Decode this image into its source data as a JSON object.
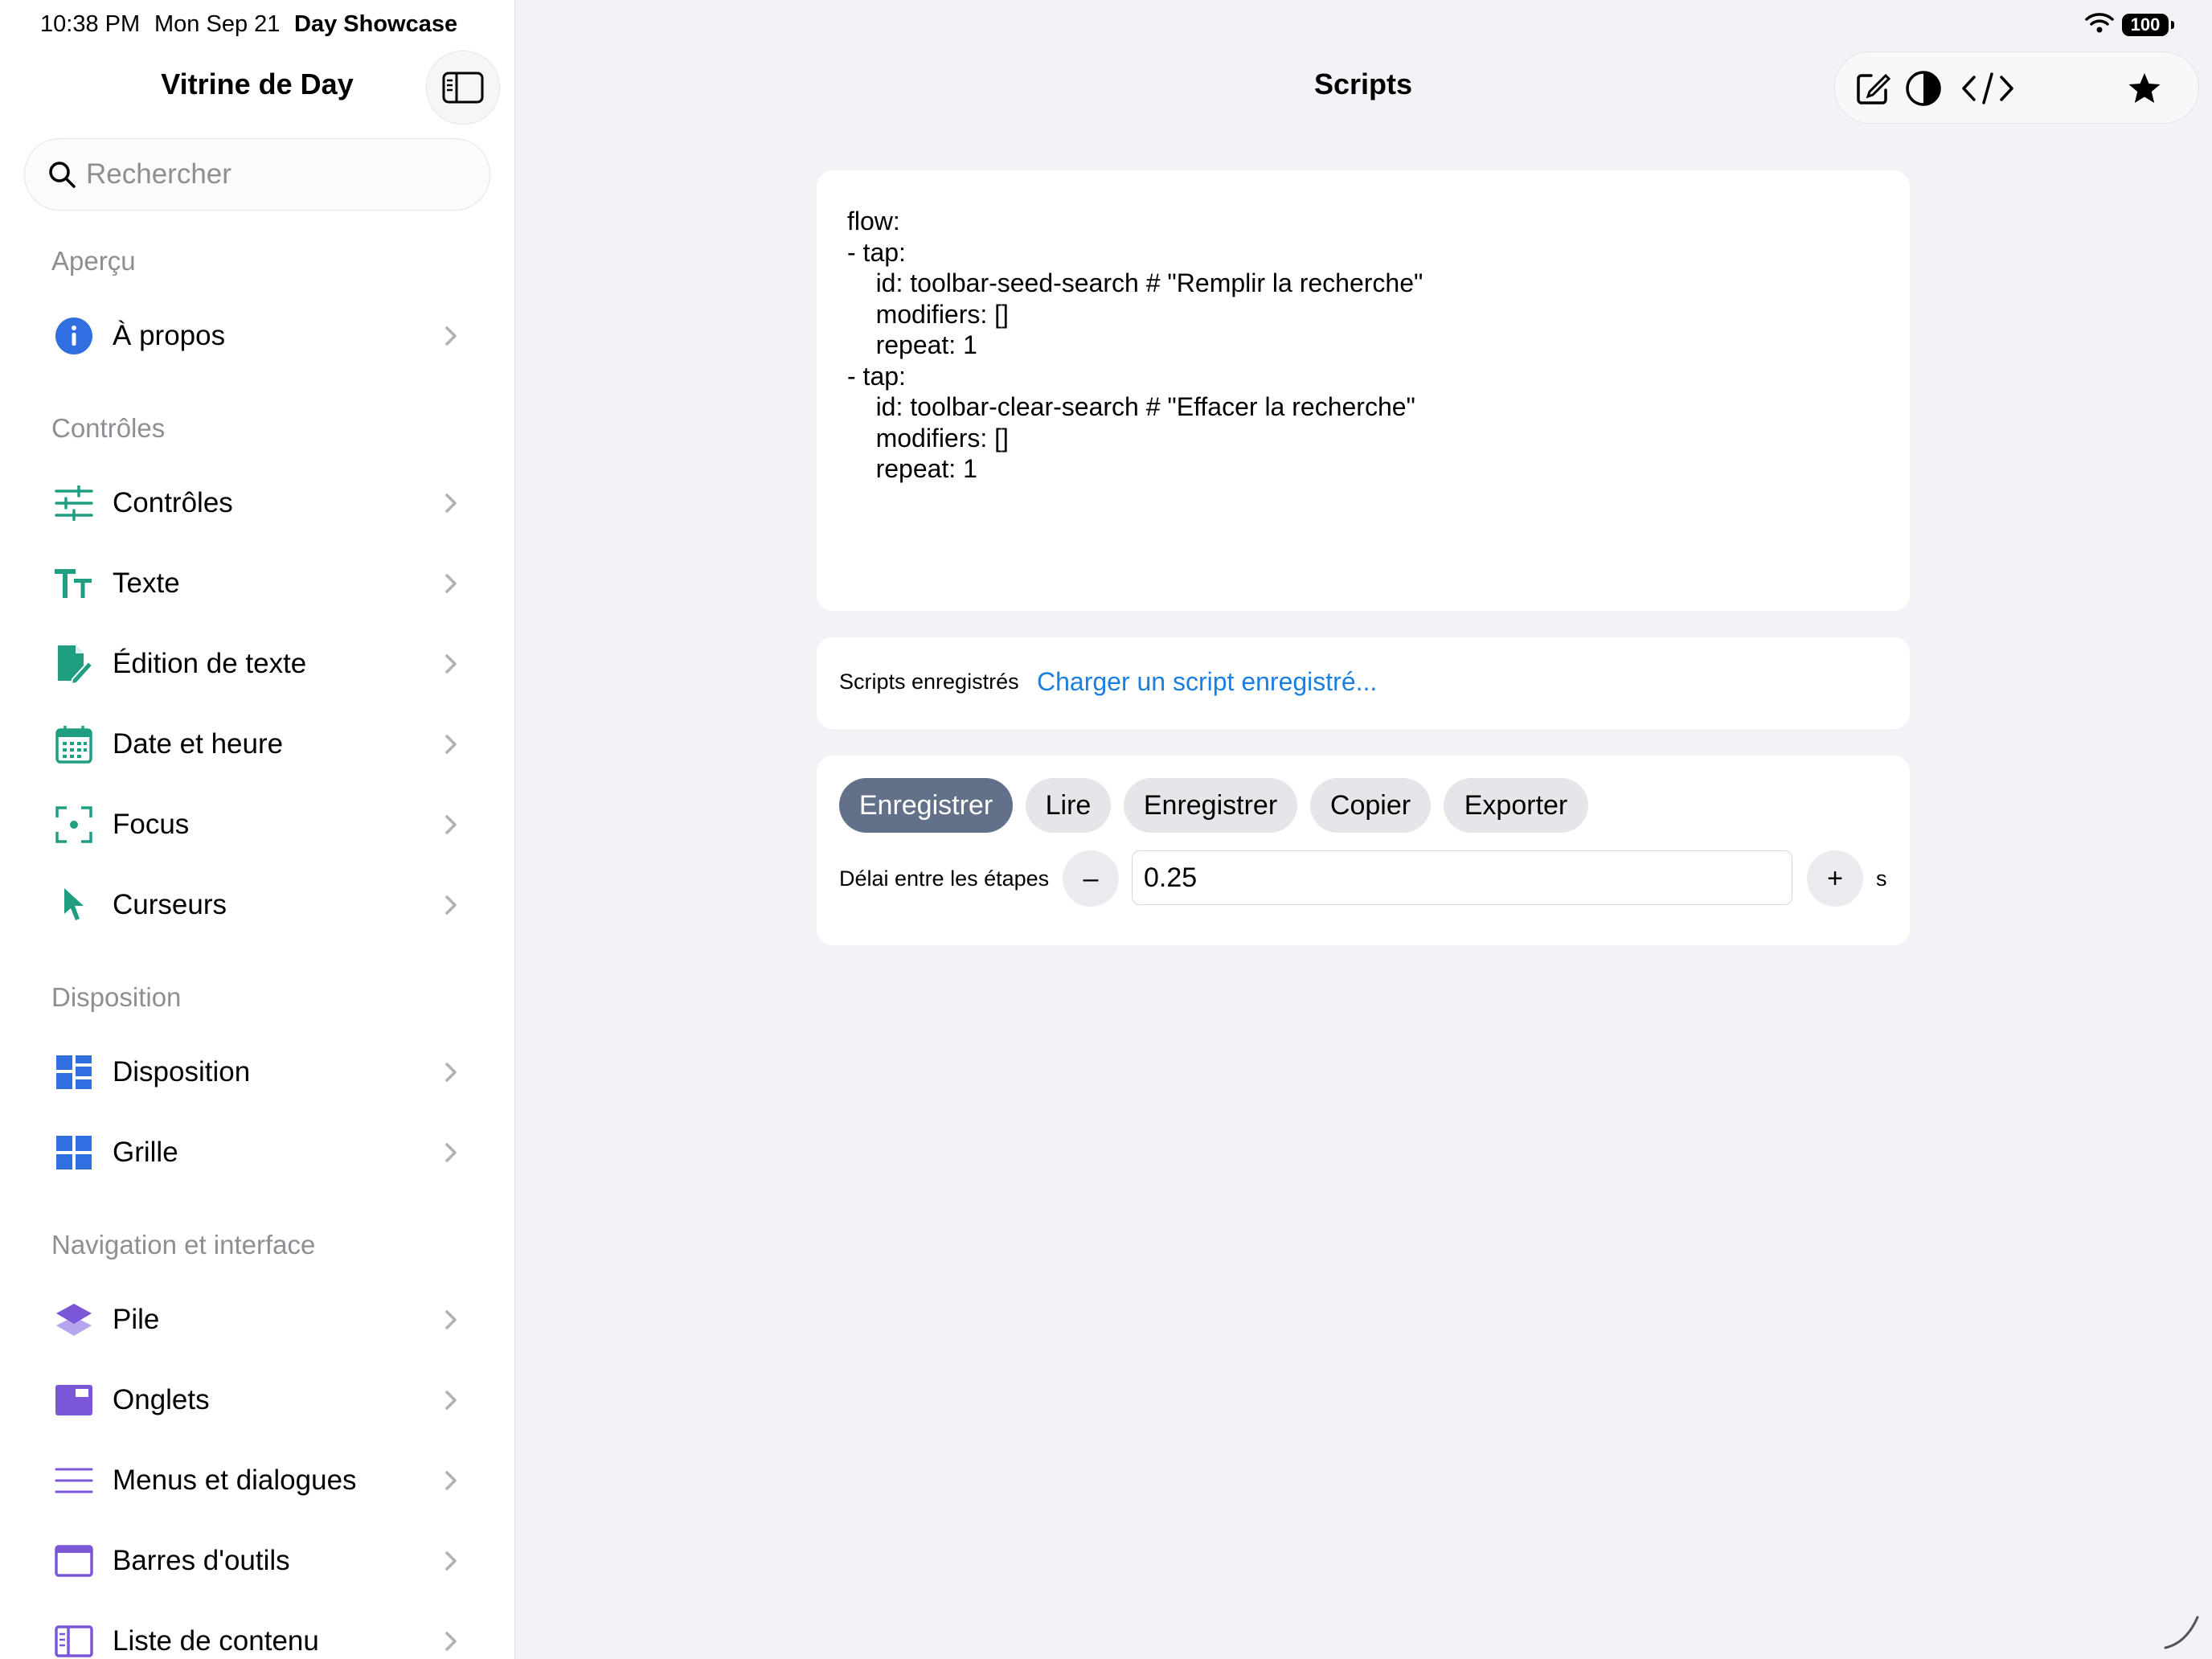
{
  "status_bar": {
    "time": "10:38 PM",
    "date": "Mon Sep 21",
    "app_name": "Day Showcase",
    "battery": "100"
  },
  "sidebar": {
    "title": "Vitrine de Day",
    "search_placeholder": "Rechercher",
    "sections": {
      "apercu": "Aperçu",
      "controles": "Contrôles",
      "disposition": "Disposition",
      "navigation": "Navigation et interface"
    },
    "items": [
      {
        "label": "À propos",
        "icon": "info-icon",
        "color": "#2f6fe0"
      },
      {
        "label": "Contrôles",
        "icon": "sliders-icon",
        "color": "#1f9e82"
      },
      {
        "label": "Texte",
        "icon": "text-size-icon",
        "color": "#1f9e82"
      },
      {
        "label": "Édition de texte",
        "icon": "document-edit-icon",
        "color": "#1f9e82"
      },
      {
        "label": "Date et heure",
        "icon": "calendar-icon",
        "color": "#1f9e82"
      },
      {
        "label": "Focus",
        "icon": "focus-icon",
        "color": "#1f9e82"
      },
      {
        "label": "Curseurs",
        "icon": "cursor-icon",
        "color": "#1f9e82"
      },
      {
        "label": "Disposition",
        "icon": "layout-icon",
        "color": "#2f6fe0"
      },
      {
        "label": "Grille",
        "icon": "grid-icon",
        "color": "#2f6fe0"
      },
      {
        "label": "Pile",
        "icon": "stack-icon",
        "color": "#7b57d8"
      },
      {
        "label": "Onglets",
        "icon": "tabs-icon",
        "color": "#7b57d8"
      },
      {
        "label": "Menus et dialogues",
        "icon": "menu-icon",
        "color": "#7b57d8"
      },
      {
        "label": "Barres d'outils",
        "icon": "toolbar-icon",
        "color": "#7b57d8"
      },
      {
        "label": "Liste de contenu",
        "icon": "sidebar-list-icon",
        "color": "#7b57d8"
      }
    ]
  },
  "main": {
    "title": "Scripts",
    "script_text": "flow:\n- tap:\n    id: toolbar-seed-search # \"Remplir la recherche\"\n    modifiers: []\n    repeat: 1\n- tap:\n    id: toolbar-clear-search # \"Effacer la recherche\"\n    modifiers: []\n    repeat: 1",
    "saved_scripts_label": "Scripts enregistrés",
    "load_saved_link": "Charger un script enregistré...",
    "buttons": {
      "record": "Enregistrer",
      "play": "Lire",
      "save": "Enregistrer",
      "copy": "Copier",
      "export": "Exporter"
    },
    "delay_label": "Délai entre les étapes",
    "delay_value": "0.25",
    "delay_unit": "s",
    "decrement": "–",
    "increment": "+"
  },
  "colors": {
    "accent": "#1a7fe0",
    "active_button": "#637089",
    "green": "#1f9e82",
    "blue": "#2f6fe0",
    "purple": "#7b57d8"
  }
}
